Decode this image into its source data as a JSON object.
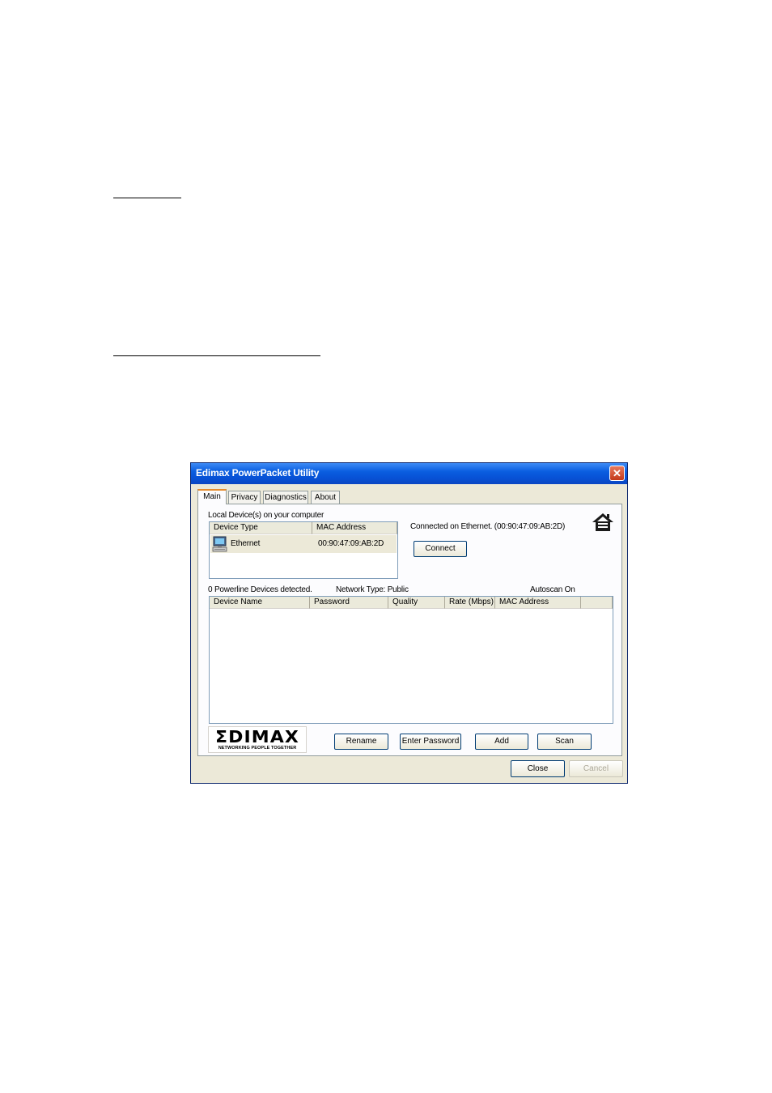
{
  "window": {
    "title": "Edimax PowerPacket Utility",
    "close_symbol": "✕"
  },
  "tabs": [
    {
      "label": "Main",
      "active": true
    },
    {
      "label": "Privacy",
      "active": false
    },
    {
      "label": "Diagnostics",
      "active": false
    },
    {
      "label": "About",
      "active": false
    }
  ],
  "local": {
    "heading": "Local Device(s) on your computer",
    "columns": [
      "Device Type",
      "MAC Address"
    ],
    "rows": [
      {
        "icon": "computer-icon",
        "device_type": "Ethernet",
        "mac": "00:90:47:09:AB:2D"
      }
    ]
  },
  "status": {
    "connected": "Connected on Ethernet. (00:90:47:09:AB:2D)",
    "connect_label": "Connect",
    "home_icon": "house-icon"
  },
  "powerline": {
    "count_text": "0 Powerline Devices detected.",
    "network_type": "Network Type: Public",
    "autoscan": "Autoscan On",
    "columns": [
      "Device Name",
      "Password",
      "Quality",
      "Rate (Mbps)",
      "MAC Address"
    ]
  },
  "logo": {
    "brand": "ΣDIMAX",
    "tagline": "NETWORKING PEOPLE TOGETHER"
  },
  "actions": {
    "rename": "Rename",
    "enter_password": "Enter Password",
    "add": "Add",
    "scan": "Scan"
  },
  "dialog": {
    "close": "Close",
    "cancel": "Cancel"
  }
}
